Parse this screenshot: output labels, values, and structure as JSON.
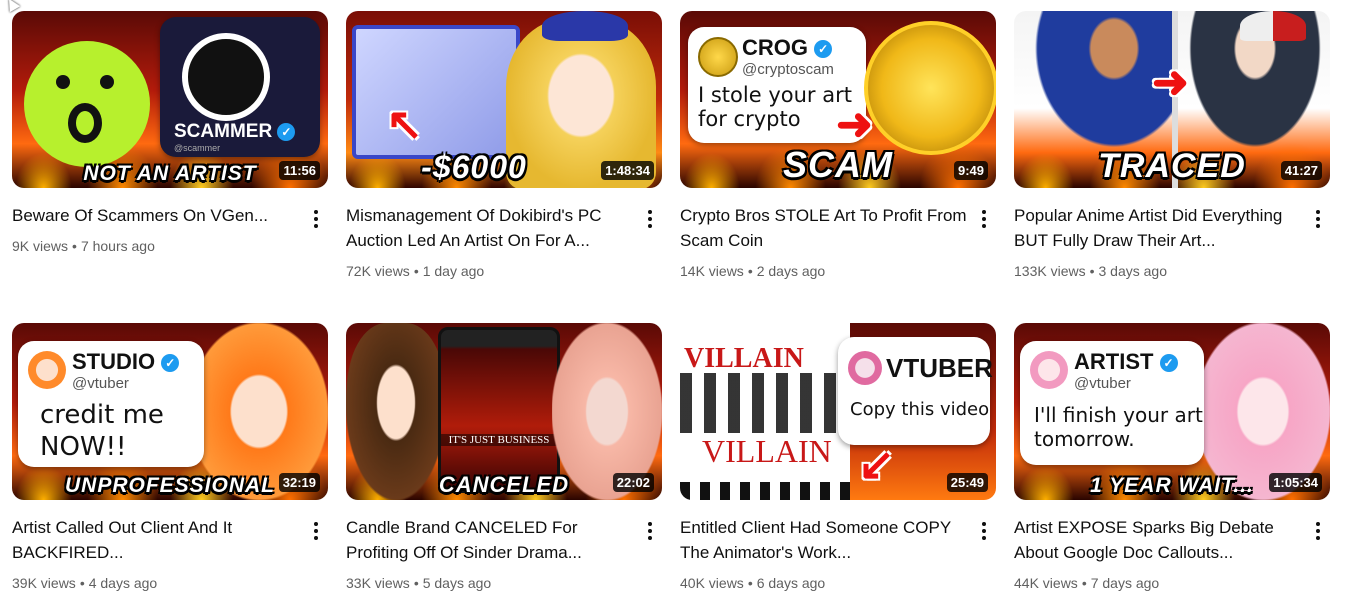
{
  "videos": [
    {
      "title": "Beware Of Scammers On VGen...",
      "views": "9K views",
      "age": "7 hours ago",
      "duration": "11:56",
      "caption": "NOT AN ARTIST",
      "card_name": "SCAMMER",
      "card_handle": "@scammer"
    },
    {
      "title": "Mismanagement Of Dokibird's PC Auction Led An Artist On For A...",
      "views": "72K views",
      "age": "1 day ago",
      "duration": "1:48:34",
      "caption": "-$6000"
    },
    {
      "title": "Crypto Bros STOLE Art To Profit From Scam Coin",
      "views": "14K views",
      "age": "2 days ago",
      "duration": "9:49",
      "caption": "SCAM",
      "card_name": "CROG",
      "card_handle": "@cryptoscam",
      "card_text": "I stole your art for crypto"
    },
    {
      "title": "Popular Anime Artist Did Everything BUT Fully Draw Their Art...",
      "views": "133K views",
      "age": "3 days ago",
      "duration": "41:27",
      "caption": "TRACED"
    },
    {
      "title": "Artist Called Out Client And It BACKFIRED...",
      "views": "39K views",
      "age": "4 days ago",
      "duration": "32:19",
      "caption": "UNPROFESSIONAL",
      "card_name": "STUDIO",
      "card_handle": "@vtuber",
      "card_text": "credit me NOW!!"
    },
    {
      "title": "Candle Brand CANCELED For Profiting Off Of Sinder Drama...",
      "views": "33K views",
      "age": "5 days ago",
      "duration": "22:02",
      "caption": "CANCELED",
      "jar_label": "IT'S JUST BUSINESS"
    },
    {
      "title": "Entitled Client Had Someone COPY The Animator's Work...",
      "views": "40K views",
      "age": "6 days ago",
      "duration": "25:49",
      "caption": "",
      "banner_top": "VILLAIN",
      "banner_bottom": "VILLAIN",
      "card_name": "VTUBER",
      "card_text": "Copy this video"
    },
    {
      "title": "Artist EXPOSE Sparks Big Debate About Google Doc Callouts...",
      "views": "44K views",
      "age": "7 days ago",
      "duration": "1:05:34",
      "caption": "1 YEAR WAIT...",
      "card_name": "ARTIST",
      "card_handle": "@vtuber",
      "card_text": "I'll finish your art tomorrow."
    }
  ],
  "separator": "•",
  "colors": {
    "title": "#0f0f0f",
    "meta": "#606060",
    "verified": "#1d9bf0",
    "accent_red": "#e11111"
  }
}
